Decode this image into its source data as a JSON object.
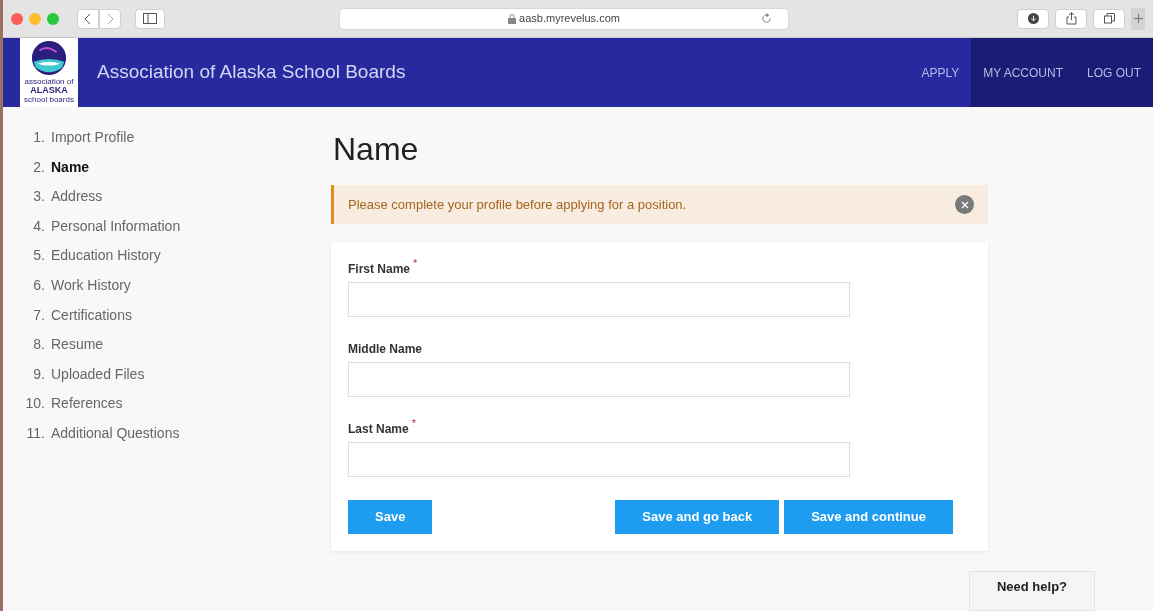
{
  "browser": {
    "address": "aasb.myrevelus.com"
  },
  "header": {
    "logo_text": [
      "association of",
      "ALASKA",
      "school boards"
    ],
    "title": "Association of Alaska School Boards",
    "nav": [
      {
        "label": "APPLY",
        "kind": "link"
      },
      {
        "label": "MY ACCOUNT",
        "kind": "account"
      },
      {
        "label": "LOG OUT",
        "kind": "account"
      }
    ]
  },
  "steps": [
    {
      "number": "1.",
      "label": "Import Profile",
      "selected": false
    },
    {
      "number": "2.",
      "label": "Name",
      "selected": true
    },
    {
      "number": "3.",
      "label": "Address",
      "selected": false
    },
    {
      "number": "4.",
      "label": "Personal Information",
      "selected": false
    },
    {
      "number": "5.",
      "label": "Education History",
      "selected": false
    },
    {
      "number": "6.",
      "label": "Work History",
      "selected": false
    },
    {
      "number": "7.",
      "label": "Certifications",
      "selected": false
    },
    {
      "number": "8.",
      "label": "Resume",
      "selected": false
    },
    {
      "number": "9.",
      "label": "Uploaded Files",
      "selected": false
    },
    {
      "number": "10.",
      "label": "References",
      "selected": false
    },
    {
      "number": "11.",
      "label": "Additional Questions",
      "selected": false
    }
  ],
  "heading": "Name",
  "alert": {
    "message": "Please complete your profile before applying for a position."
  },
  "form": {
    "fields": [
      {
        "label": "First Name",
        "required": true
      },
      {
        "label": "Middle Name",
        "required": false
      },
      {
        "label": "Last Name",
        "required": true
      }
    ],
    "required_mark": "*",
    "buttons": [
      "Save",
      "Save and go back",
      "Save and continue"
    ]
  },
  "help": "Need help?"
}
